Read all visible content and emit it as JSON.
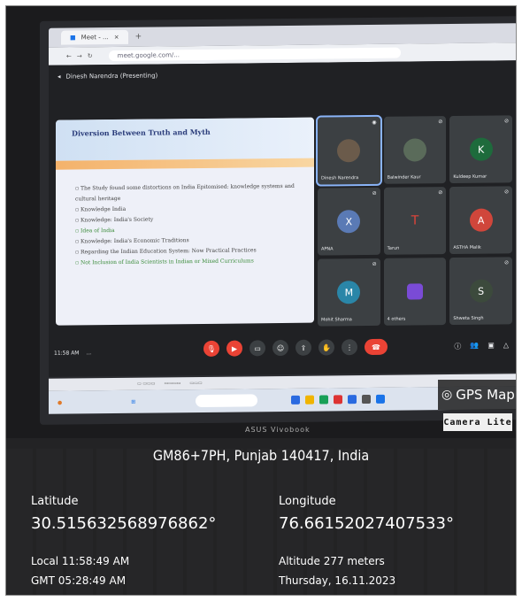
{
  "browser": {
    "tab_label": "Meet - ...",
    "url": "meet.google.com/..."
  },
  "meet": {
    "presenter_label": "Dinesh Narendra (Presenting)",
    "time_label": "11:58 AM",
    "meeting_code": "...",
    "slide": {
      "title": "Diversion Between Truth and Myth",
      "points": [
        "The Study found some distortions on India Epitomised: knowledge systems and cultural heritage",
        "Knowledge India",
        "Knowledge: India's Society",
        "Idea of India",
        "Knowledge: India's Economic Traditions",
        "Regarding the Indian Education System: Now Practical Practices",
        "Not Inclusion of India Scientists in Indian or Mixed Curriculums"
      ]
    },
    "participants": [
      {
        "name": "Dinesh Narendra",
        "initial": "",
        "color": "#6b5b4b",
        "active": true
      },
      {
        "name": "Balwinder Kaur",
        "initial": "",
        "color": "#5a6b5a",
        "active": false
      },
      {
        "name": "Kuldeep Kumar",
        "initial": "K",
        "color": "#1e6b3c",
        "active": false
      },
      {
        "name": "APNA",
        "initial": "X",
        "color": "#5a7ab5",
        "active": false
      },
      {
        "name": "Tarun",
        "initial": "T",
        "color": "#e0443a",
        "active": false
      },
      {
        "name": "ASTHA Malik",
        "initial": "A",
        "color": "#d0463b",
        "active": false
      },
      {
        "name": "Mohit Sharma",
        "initial": "M",
        "color": "#2a86a8",
        "active": false
      },
      {
        "name": "4 others",
        "initial": "",
        "color": "#7a4bd6",
        "active": false
      },
      {
        "name": "Shweta Singh",
        "initial": "S",
        "color": "#3c4a3c",
        "active": false
      }
    ]
  },
  "laptop_brand": "ASUS Vivobook",
  "gps_app": {
    "name": "GPS Map",
    "edition": "Camera Lite"
  },
  "location": {
    "address": "GM86+7PH, Punjab 140417, India",
    "latitude_label": "Latitude",
    "latitude": "30.515632568976862°",
    "longitude_label": "Longitude",
    "longitude": "76.66152027407533°",
    "local_time": "Local 11:58:49 AM",
    "gmt_time": "GMT 05:28:49 AM",
    "altitude": "Altitude 277 meters",
    "date": "Thursday, 16.11.2023"
  }
}
